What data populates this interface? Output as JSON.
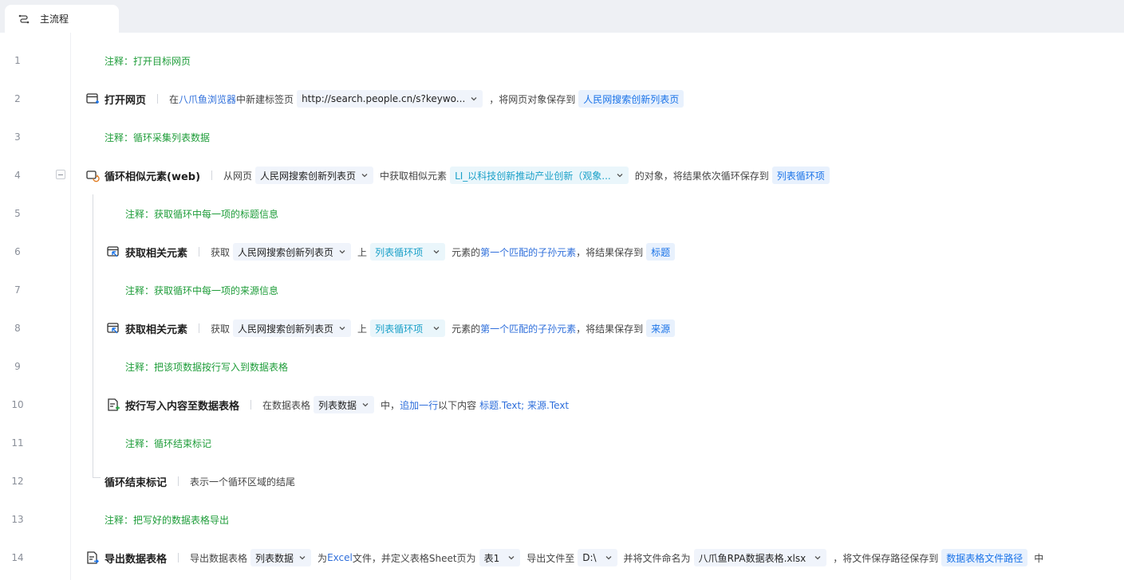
{
  "tab": {
    "label": "主流程",
    "icon": "flow-icon"
  },
  "lines": [
    {
      "num": "1",
      "comment": "注释：打开目标网页"
    },
    {
      "num": "2",
      "title": "打开网页",
      "t1": "在",
      "link": "八爪鱼浏览器",
      "t2": "中新建标签页",
      "url": "http://search.people.cn/s?keywo...",
      "t3": "，将网页对象保存到",
      "var": "人民网搜索创新列表页"
    },
    {
      "num": "3",
      "comment": "注释：循环采集列表数据"
    },
    {
      "num": "4",
      "title": "循环相似元素(web)",
      "t1": "从网页",
      "page": "人民网搜索创新列表页",
      "t2": "中获取相似元素",
      "elem": "LI_以科技创新推动产业创新（观象...",
      "t3": "的对象，将结果依次循环保存到",
      "var": "列表循环项"
    },
    {
      "num": "5",
      "comment": "注释：获取循环中每一项的标题信息"
    },
    {
      "num": "6",
      "title": "获取相关元素",
      "t1": "获取",
      "page": "人民网搜索创新列表页",
      "t2": "上",
      "item": "列表循环项",
      "t3": "元素的",
      "link": "第一个匹配的子孙元素",
      "t4": "，将结果保存到",
      "var": "标题"
    },
    {
      "num": "7",
      "comment": "注释：获取循环中每一项的来源信息"
    },
    {
      "num": "8",
      "title": "获取相关元素",
      "t1": "获取",
      "page": "人民网搜索创新列表页",
      "t2": "上",
      "item": "列表循环项",
      "t3": "元素的",
      "link": "第一个匹配的子孙元素",
      "t4": "，将结果保存到",
      "var": "来源"
    },
    {
      "num": "9",
      "comment": "注释：把该项数据按行写入到数据表格"
    },
    {
      "num": "10",
      "title": "按行写入内容至数据表格",
      "t1": "在数据表格",
      "table": "列表数据",
      "t2": "中，",
      "link": "追加一行",
      "t3": "以下内容",
      "value": "标题.Text; 来源.Text"
    },
    {
      "num": "11",
      "comment": "注释：循环结束标记"
    },
    {
      "num": "12",
      "title": "循环结束标记",
      "t1": "表示一个循环区域的结尾"
    },
    {
      "num": "13",
      "comment": "注释：把写好的数据表格导出"
    },
    {
      "num": "14",
      "title": "导出数据表格",
      "t1": "导出数据表格",
      "table": "列表数据",
      "t2": "为",
      "link": "Excel",
      "t3": "文件，并定义表格Sheet页为",
      "sheet": "表1",
      "t4": "导出文件至",
      "dir": "D:\\",
      "t5": "并将文件命名为",
      "filename": "八爪鱼RPA数据表格.xlsx",
      "t6": "，将文件保存路径保存到",
      "var": "数据表格文件路径",
      "t7": "中"
    }
  ],
  "colors": {
    "comment": "#1f9d3a",
    "link": "#2f6fdb",
    "var_text": "#1a73e8",
    "var_bg": "#e8f1fd"
  }
}
